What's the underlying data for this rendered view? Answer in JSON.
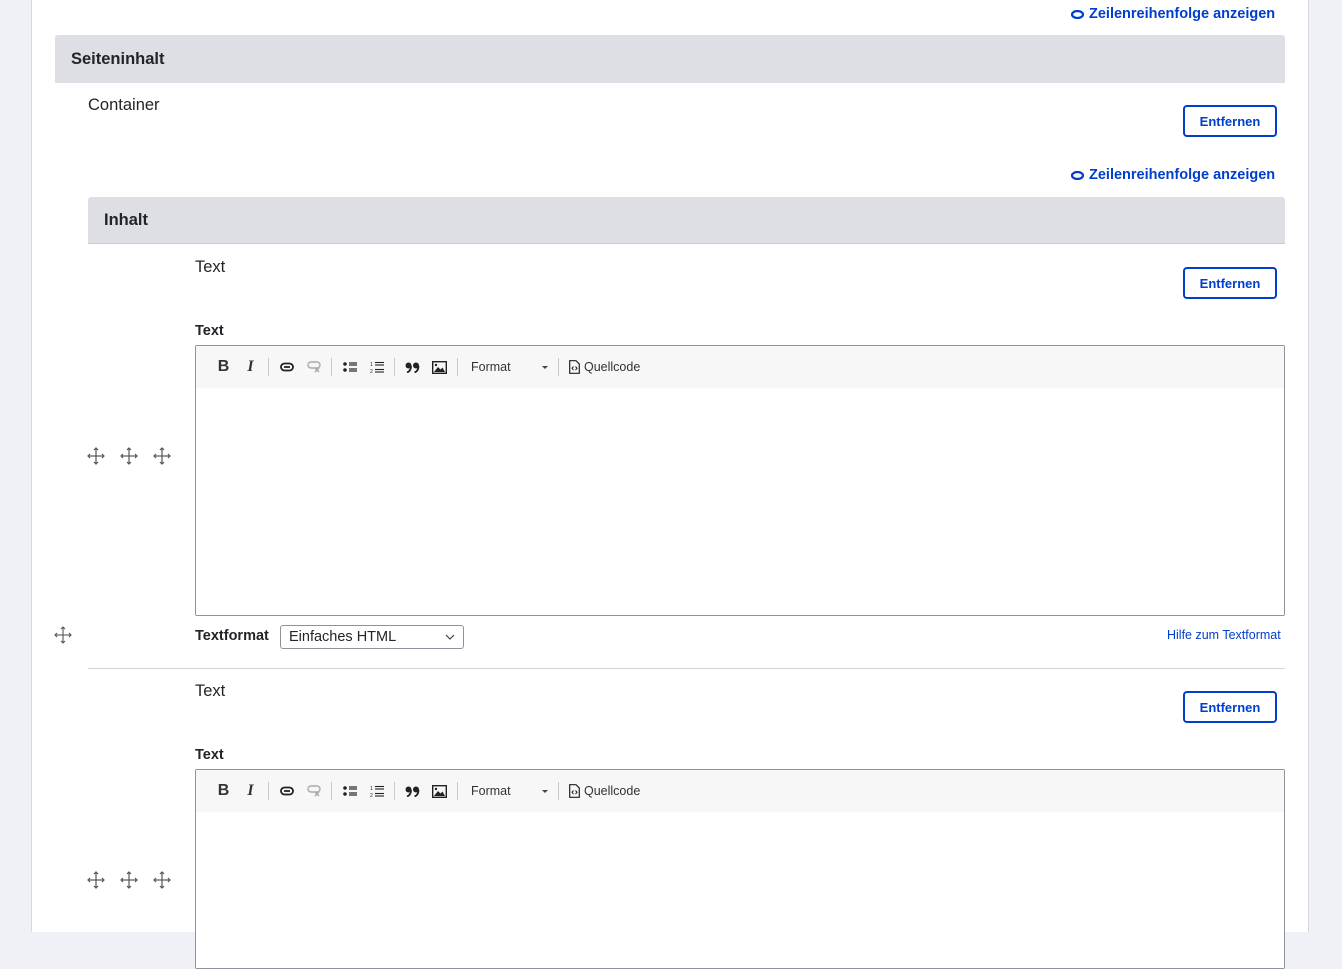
{
  "row_order_link": "Zeilenreihenfolge anzeigen",
  "outer_section": {
    "title": "Seiteninhalt",
    "paragraph_type": "Container",
    "remove_label": "Entfernen"
  },
  "inner_section": {
    "title": "Inhalt"
  },
  "items": [
    {
      "paragraph_type": "Text",
      "remove_label": "Entfernen",
      "field_label": "Text",
      "editor_value": "",
      "textformat_label": "Textformat",
      "textformat_value": "Einfaches HTML",
      "help_link": "Hilfe zum Textformat"
    },
    {
      "paragraph_type": "Text",
      "remove_label": "Entfernen",
      "field_label": "Text",
      "editor_value": ""
    }
  ],
  "toolbar": {
    "bold": "B",
    "italic": "I",
    "link": "link-icon",
    "unlink": "unlink-icon",
    "bulleted_list": "bulleted-list-icon",
    "numbered_list": "numbered-list-icon",
    "blockquote": "blockquote-icon",
    "image": "image-icon",
    "format_label": "Format",
    "source_label": "Quellcode"
  },
  "colors": {
    "accent": "#003ecc",
    "header_bg": "#dedfe4",
    "text": "#232429",
    "page_bg": "#f0f1f6"
  }
}
